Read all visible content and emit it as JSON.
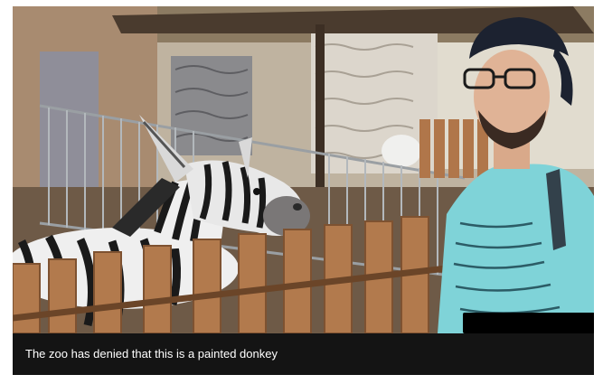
{
  "caption": {
    "text": "The zoo has denied that this is a painted donkey"
  },
  "image": {
    "subject": "zebra-striped-donkey-icon",
    "person": "person-icon"
  },
  "colors": {
    "caption_bg": "#141414",
    "caption_text": "#ffffff",
    "shirt": "#7fd3d8",
    "cap": "#1c2230"
  }
}
